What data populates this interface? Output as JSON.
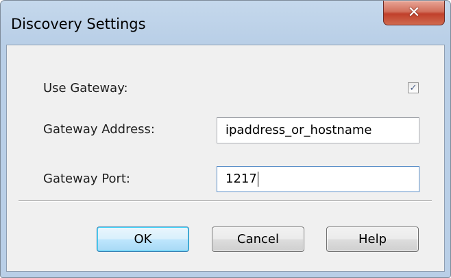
{
  "window": {
    "title": "Discovery Settings",
    "close_glyph": "✕"
  },
  "form": {
    "use_gateway": {
      "label": "Use Gateway:",
      "checked": true
    },
    "gateway_address": {
      "label": "Gateway Address:",
      "value": "ipaddress_or_hostname"
    },
    "gateway_port": {
      "label": "Gateway Port:",
      "value": "1217"
    }
  },
  "buttons": {
    "ok": "OK",
    "cancel": "Cancel",
    "help": "Help"
  },
  "colors": {
    "accent": "#3c7fb1",
    "close_red": "#c1402b",
    "frame_blue": "#b9cfe7"
  }
}
